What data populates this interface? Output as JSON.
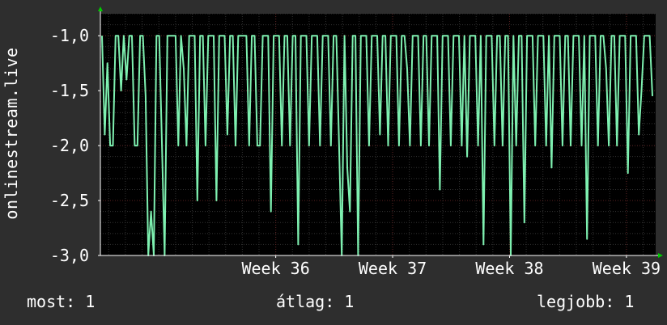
{
  "colors": {
    "background": "#2e2e2e",
    "plot_background": "#000000",
    "line": "#7ef0b0",
    "grid_major": "#5a2020",
    "grid_minor": "#333333",
    "text": "#ffffff",
    "axis_arrow": "#00cc00"
  },
  "stats": {
    "now": "most: 1",
    "avg": "átlag: 1",
    "max": "legjobb: 1"
  },
  "chart_data": {
    "type": "line",
    "ylabel": "onlinestream.live",
    "ylim": [
      -3.0,
      -0.8
    ],
    "yticks": [
      -1.0,
      -1.5,
      -2.0,
      -2.5,
      -3.0
    ],
    "ytick_labels": [
      "-1,0",
      "-1,5",
      "-2,0",
      "-2,5",
      "-3,0"
    ],
    "xlim": [
      34.5,
      39.25
    ],
    "xticks": [
      36,
      37,
      38,
      39
    ],
    "xtick_labels": [
      "Week 36",
      "Week 37",
      "Week 38",
      "Week 39"
    ],
    "grid": true,
    "series": [
      {
        "values": [
          -1.0,
          -1.9,
          -1.25,
          -2.0,
          -2.0,
          -1.0,
          -1.0,
          -1.5,
          -1.0,
          -1.4,
          -1.0,
          -1.0,
          -2.0,
          -2.0,
          -1.0,
          -1.0,
          -1.55,
          -3.0,
          -2.6,
          -3.0,
          -1.0,
          -1.0,
          -2.0,
          -3.0,
          -1.0,
          -1.0,
          -1.0,
          -1.0,
          -2.0,
          -1.0,
          -1.3,
          -2.0,
          -1.0,
          -1.0,
          -1.0,
          -2.5,
          -1.0,
          -1.0,
          -2.0,
          -1.0,
          -1.0,
          -1.0,
          -2.5,
          -1.0,
          -1.0,
          -1.0,
          -1.9,
          -1.0,
          -1.0,
          -2.0,
          -1.0,
          -1.0,
          -1.0,
          -1.0,
          -2.0,
          -1.0,
          -1.0,
          -2.0,
          -2.0,
          -1.0,
          -1.0,
          -1.0,
          -2.6,
          -1.0,
          -1.0,
          -1.0,
          -2.0,
          -1.0,
          -1.0,
          -2.0,
          -1.0,
          -1.0,
          -2.9,
          -1.0,
          -1.0,
          -1.0,
          -2.0,
          -1.0,
          -1.0,
          -1.0,
          -2.0,
          -1.0,
          -1.0,
          -1.0,
          -2.0,
          -1.0,
          -1.0,
          -2.0,
          -3.0,
          -1.0,
          -2.2,
          -2.6,
          -1.0,
          -1.0,
          -3.0,
          -1.0,
          -1.0,
          -1.0,
          -2.0,
          -1.0,
          -1.0,
          -1.0,
          -1.9,
          -1.0,
          -1.0,
          -2.0,
          -1.0,
          -1.0,
          -1.0,
          -2.0,
          -1.0,
          -1.0,
          -1.3,
          -2.0,
          -1.0,
          -1.0,
          -1.0,
          -2.0,
          -1.0,
          -1.0,
          -2.0,
          -1.0,
          -1.0,
          -1.0,
          -2.4,
          -1.0,
          -1.0,
          -1.0,
          -2.0,
          -1.0,
          -1.0,
          -1.0,
          -2.0,
          -1.0,
          -2.1,
          -1.0,
          -1.0,
          -1.0,
          -2.0,
          -1.0,
          -2.9,
          -1.0,
          -1.0,
          -1.0,
          -2.0,
          -1.0,
          -1.0,
          -2.0,
          -1.0,
          -1.0,
          -3.0,
          -1.0,
          -2.0,
          -1.0,
          -1.0,
          -2.7,
          -1.0,
          -1.0,
          -1.0,
          -2.0,
          -1.0,
          -1.0,
          -1.0,
          -2.0,
          -1.0,
          -2.2,
          -1.0,
          -1.0,
          -1.0,
          -2.0,
          -1.0,
          -1.0,
          -2.0,
          -1.0,
          -1.0,
          -1.0,
          -2.0,
          -1.0,
          -2.85,
          -1.0,
          -1.0,
          -1.0,
          -2.0,
          -1.0,
          -1.0,
          -1.3,
          -2.0,
          -1.0,
          -1.0,
          -2.0,
          -1.0,
          -1.0,
          -1.0,
          -2.25,
          -1.0,
          -1.0,
          -1.0,
          -1.9,
          -1.5,
          -1.0,
          -1.0,
          -1.0,
          -1.55
        ]
      }
    ]
  }
}
